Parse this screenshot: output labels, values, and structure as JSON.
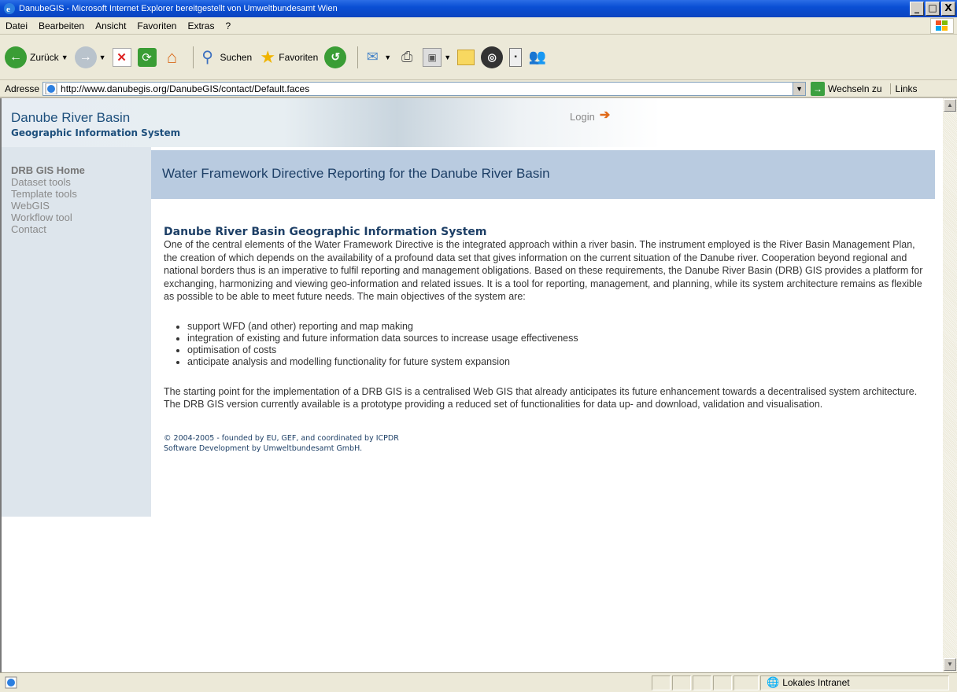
{
  "window": {
    "title": "DanubeGIS - Microsoft Internet Explorer bereitgestellt von Umweltbundesamt Wien",
    "controls": [
      "_",
      "□",
      "X"
    ]
  },
  "menu": {
    "items": [
      "Datei",
      "Bearbeiten",
      "Ansicht",
      "Favoriten",
      "Extras",
      "?"
    ]
  },
  "toolbar": {
    "back_label": "Zurück",
    "search_label": "Suchen",
    "favorites_label": "Favoriten"
  },
  "address": {
    "label": "Adresse",
    "url": "http://www.danubegis.org/DanubeGIS/contact/Default.faces",
    "go_label": "Wechseln zu",
    "links_label": "Links"
  },
  "header": {
    "site_title": "Danube River Basin",
    "site_subtitle": "Geographic Information System",
    "login_label": "Login"
  },
  "nav": {
    "items": [
      "DRB GIS Home",
      "Dataset tools",
      "Template tools",
      "WebGIS",
      "Workflow tool",
      "Contact"
    ]
  },
  "banner": {
    "title": "Water Framework Directive Reporting for the Danube River Basin"
  },
  "main": {
    "heading": "Danube River Basin Geographic Information System",
    "intro": "One of the central elements of the Water Framework Directive is the integrated approach within a river basin. The instrument employed is the River Basin Management Plan, the creation of which depends on the availability of a profound data set that gives information on the current situation of the Danube river. Cooperation beyond regional and national borders thus is an imperative to fulfil reporting and management obligations. Based on these requirements, the Danube River Basin (DRB) GIS provides a platform for exchanging, harmonizing and viewing geo-information and related issues. It is a tool for reporting, management, and planning, while its system architecture remains as flexible as possible to be able to meet future needs. The main objectives of the system are:",
    "objectives": [
      "support WFD (and other) reporting and map making",
      "integration of existing and future information data sources to increase usage effectiveness",
      "optimisation of costs",
      "anticipate analysis and modelling functionality for future system expansion"
    ],
    "paragraph2": "The starting point for the implementation of a DRB GIS is a centralised Web GIS that already anticipates its future enhancement towards a decentralised system architecture. The DRB GIS version currently available is a prototype providing a reduced set of functionalities for data up- and download, validation and visualisation.",
    "footer_line1": "© 2004-2005 - founded by EU, GEF, and coordinated by ICPDR",
    "footer_line2": "Software Development by Umweltbundesamt GmbH."
  },
  "status": {
    "zone_label": "Lokales Intranet"
  }
}
